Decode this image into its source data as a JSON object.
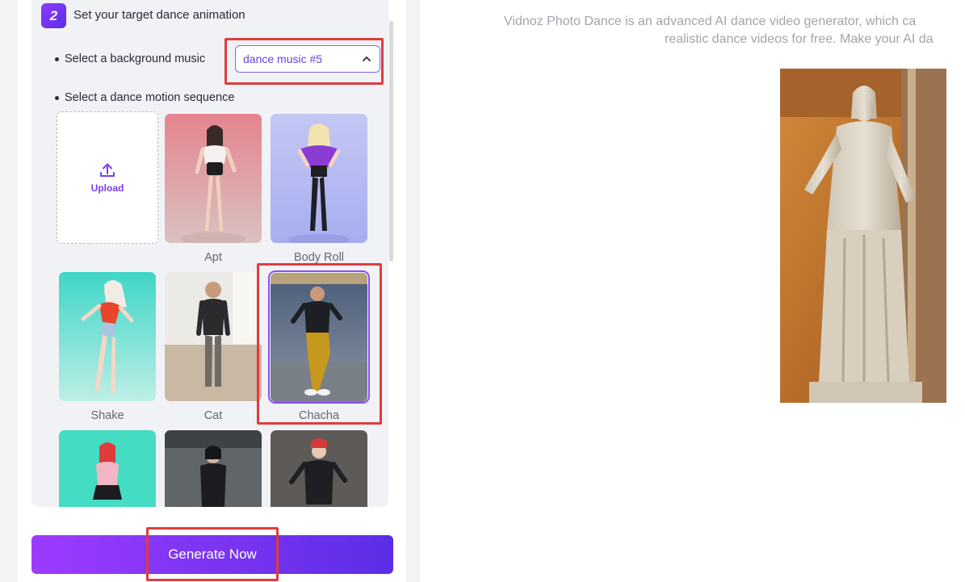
{
  "step": {
    "number": "2",
    "title": "Set your target dance animation"
  },
  "music": {
    "label": "Select a background music",
    "selected": "dance music #5"
  },
  "motion": {
    "label": "Select a dance motion sequence",
    "upload_label": "Upload",
    "items": [
      {
        "label": "Apt"
      },
      {
        "label": "Body Roll"
      },
      {
        "label": "Shake"
      },
      {
        "label": "Cat"
      },
      {
        "label": "Chacha",
        "selected": true
      }
    ]
  },
  "generate_label": "Generate Now",
  "description": {
    "line1": "Vidnoz Photo Dance is an advanced AI dance video generator, which ca",
    "line2": "realistic dance videos for free. Make your AI da"
  },
  "colors": {
    "accent": "#7a3df0",
    "highlight": "#e03c3c"
  }
}
